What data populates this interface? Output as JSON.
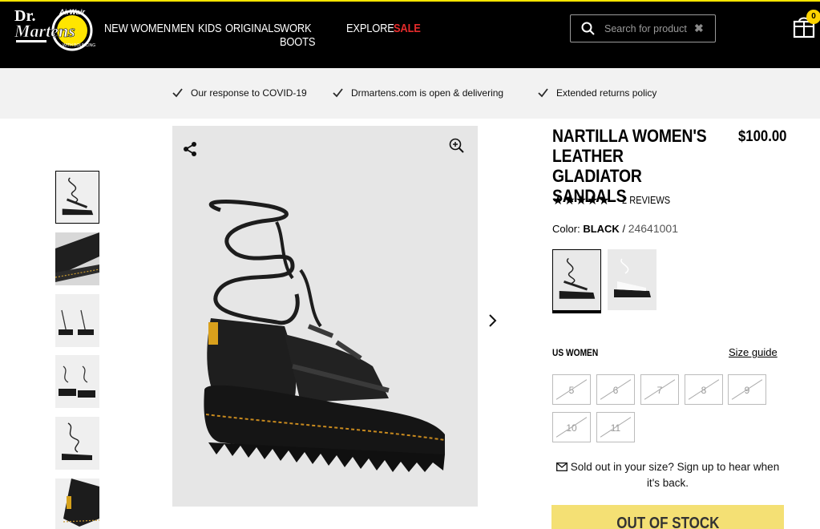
{
  "header": {
    "brand": "Dr. Martens",
    "nav": [
      {
        "label": "NEW"
      },
      {
        "label": "WOMEN"
      },
      {
        "label": "MEN"
      },
      {
        "label": "KIDS"
      },
      {
        "label": "ORIGINALS"
      },
      {
        "label": "WORK BOOTS"
      },
      {
        "label": "EXPLORE"
      },
      {
        "label": "SALE"
      }
    ],
    "search_placeholder": "Search for product",
    "cart_count": "0"
  },
  "notices": [
    {
      "label": "Our response to COVID-19"
    },
    {
      "label": "Drmartens.com is open & delivering"
    },
    {
      "label": "Extended returns policy"
    }
  ],
  "product": {
    "title": "NARTILLA WOMEN'S LEATHER GLADIATOR SANDALS",
    "price": "$100.00",
    "rating_stars": "★★★★★",
    "reviews": "2 REVIEWS",
    "color_label": "Color:",
    "color_value": "BLACK",
    "color_sep": "/",
    "sku": "24641001",
    "size_heading": "US WOMEN",
    "size_guide": "Size guide",
    "sizes": [
      "5",
      "6",
      "7",
      "8",
      "9",
      "10",
      "11"
    ],
    "soldout_message": "Sold out in your size? Sign up to hear when it's back.",
    "cta_label": "OUT OF STOCK"
  },
  "colors": {
    "accent_yellow": "#ffe500",
    "sale_red": "#e32b2b",
    "cta_bg": "#f4e074"
  }
}
